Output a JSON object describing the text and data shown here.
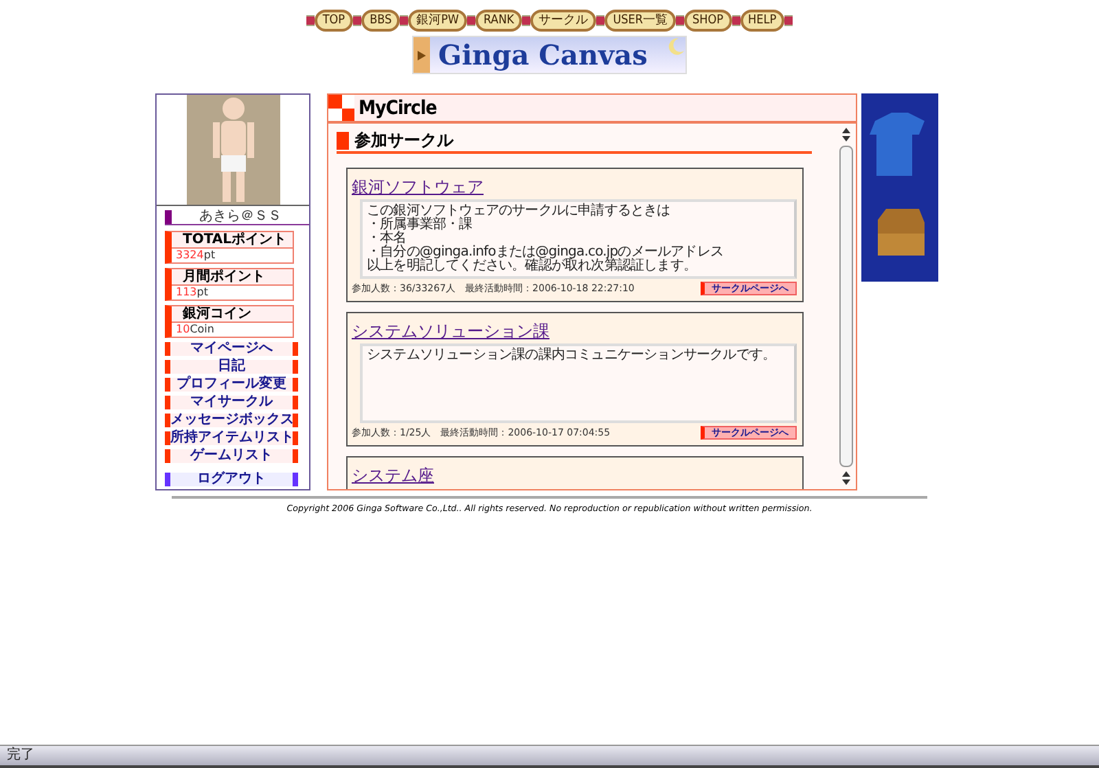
{
  "nav": [
    {
      "label": "TOP"
    },
    {
      "label": "BBS"
    },
    {
      "label": "銀河PW"
    },
    {
      "label": "RANK"
    },
    {
      "label": "サークル"
    },
    {
      "label": "USER一覧"
    },
    {
      "label": "SHOP"
    },
    {
      "label": "HELP"
    }
  ],
  "banner": {
    "title": "Ginga Canvas"
  },
  "profile": {
    "name": "あきら＠ＳＳ",
    "stats": [
      {
        "label": "TOTALポイント",
        "value": "3324",
        "unit": "pt"
      },
      {
        "label": "月間ポイント",
        "value": "113",
        "unit": "pt"
      },
      {
        "label": "銀河コイン",
        "value": "10",
        "unit": "Coin"
      }
    ],
    "mypage": "マイページへ",
    "menu": [
      "日記",
      "プロフィール変更",
      "マイサークル",
      "メッセージボックス",
      "所持アイテムリスト",
      "ゲームリスト"
    ],
    "logout": "ログアウト"
  },
  "main": {
    "title": "MyCircle",
    "section": "参加サークル",
    "circles": [
      {
        "name": "銀河ソフトウェア",
        "description": [
          "この銀河ソフトウェアのサークルに申請するときは",
          "・所属事業部・課",
          "・本名",
          "・自分の@ginga.infoまたは@ginga.co.jpのメールアドレス",
          "以上を明記してください。確認が取れ次第認証します。"
        ],
        "stats": "参加人数：36/33267人　最終活動時間：2006-10-18 22:27:10",
        "button": "サークルページへ"
      },
      {
        "name": "システムソリューション課",
        "description": [
          "システムソリューション課の課内コミュニケーションサークルです。"
        ],
        "stats": "参加人数：1/25人　最終活動時間：2006-10-17 07:04:55",
        "button": "サークルページへ"
      },
      {
        "name": "システム座"
      }
    ]
  },
  "footer": "Copyright 2006 Ginga Software Co.,Ltd.. All rights reserved. No reproduction or republication without written permission.",
  "status_bar": "完了"
}
